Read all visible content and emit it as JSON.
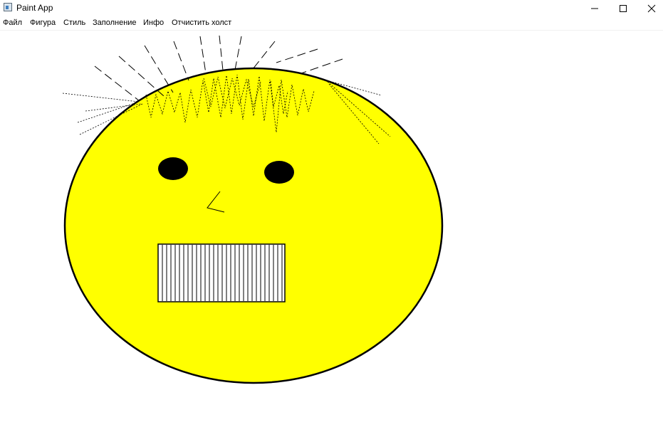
{
  "window": {
    "title": "Paint App",
    "icon": "app-window-icon",
    "controls": [
      "minimize-icon",
      "maximize-icon",
      "close-icon"
    ]
  },
  "menu": {
    "file": "Файл",
    "shape": "Фигура",
    "style": "Стиль",
    "fill": "Заполнение",
    "info": "Инфо",
    "clear": "Отчистить холст"
  },
  "colors": {
    "face_fill": "#ffff00",
    "outline": "#000000",
    "background": "#ffffff"
  }
}
